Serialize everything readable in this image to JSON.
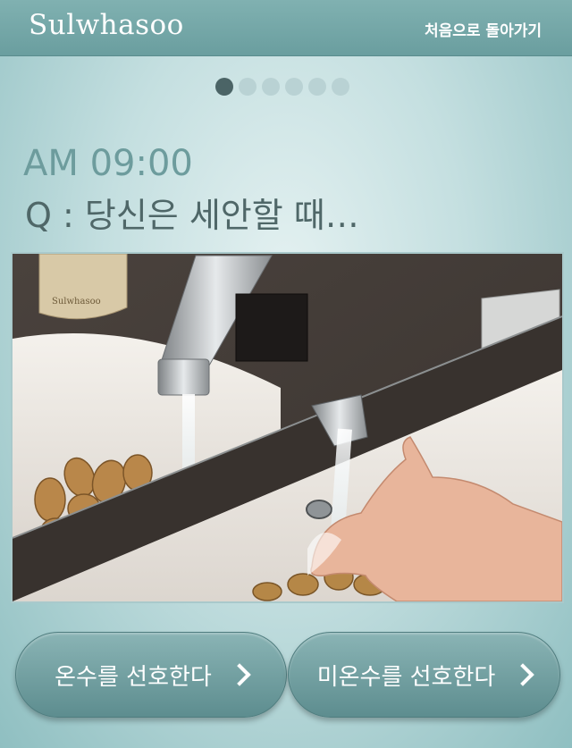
{
  "header": {
    "logo_text": "Sulwhasoo",
    "back_label": "처음으로 돌아가기"
  },
  "pagination": {
    "total": 6,
    "active": 1
  },
  "question": {
    "time": "AM 09:00",
    "text": "Q : 당신은 세안할 때…"
  },
  "photo": {
    "bottle_label": "Sulwhasoo"
  },
  "answers": {
    "warm_label": "온수를 선호한다",
    "cold_label": "미온수를 선호한다"
  },
  "colors": {
    "accent": "#6a9e9f",
    "dot_active": "#4b6466",
    "dot_inactive": "#b9d2d4"
  }
}
